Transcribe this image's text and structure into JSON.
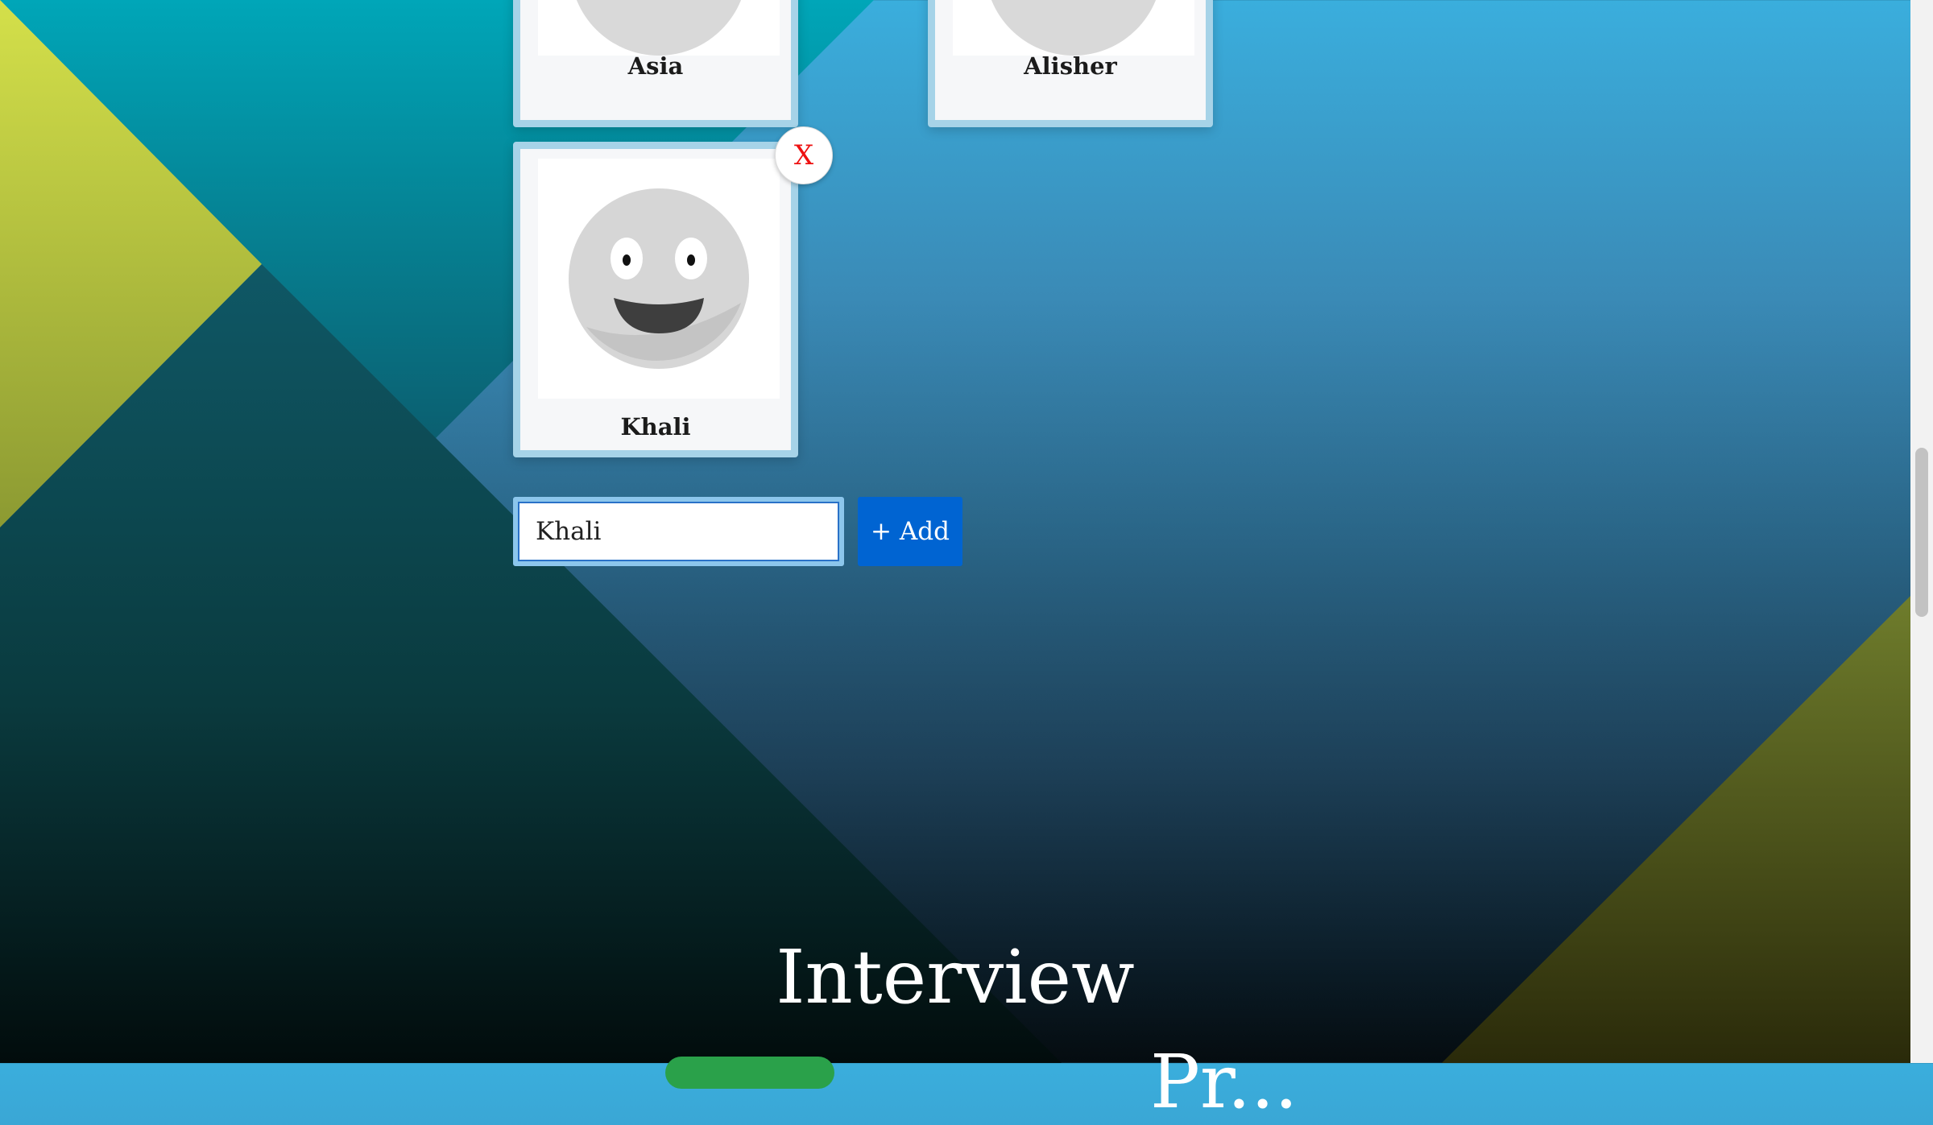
{
  "participants": [
    {
      "name": "Asia"
    },
    {
      "name": "Alisher"
    },
    {
      "name": "Khali",
      "remove_label": "X"
    }
  ],
  "add_form": {
    "input_value": "Khali",
    "button_label": "+ Add"
  },
  "section": {
    "title": "Interview",
    "next_title": "Pr..."
  },
  "colors": {
    "card_border": "#a6d3e8",
    "add_button": "#0064d2",
    "remove_x": "#ee1111",
    "pill": "#2aa14a"
  },
  "icons": [
    "smiley-avatar-icon",
    "close-icon"
  ]
}
